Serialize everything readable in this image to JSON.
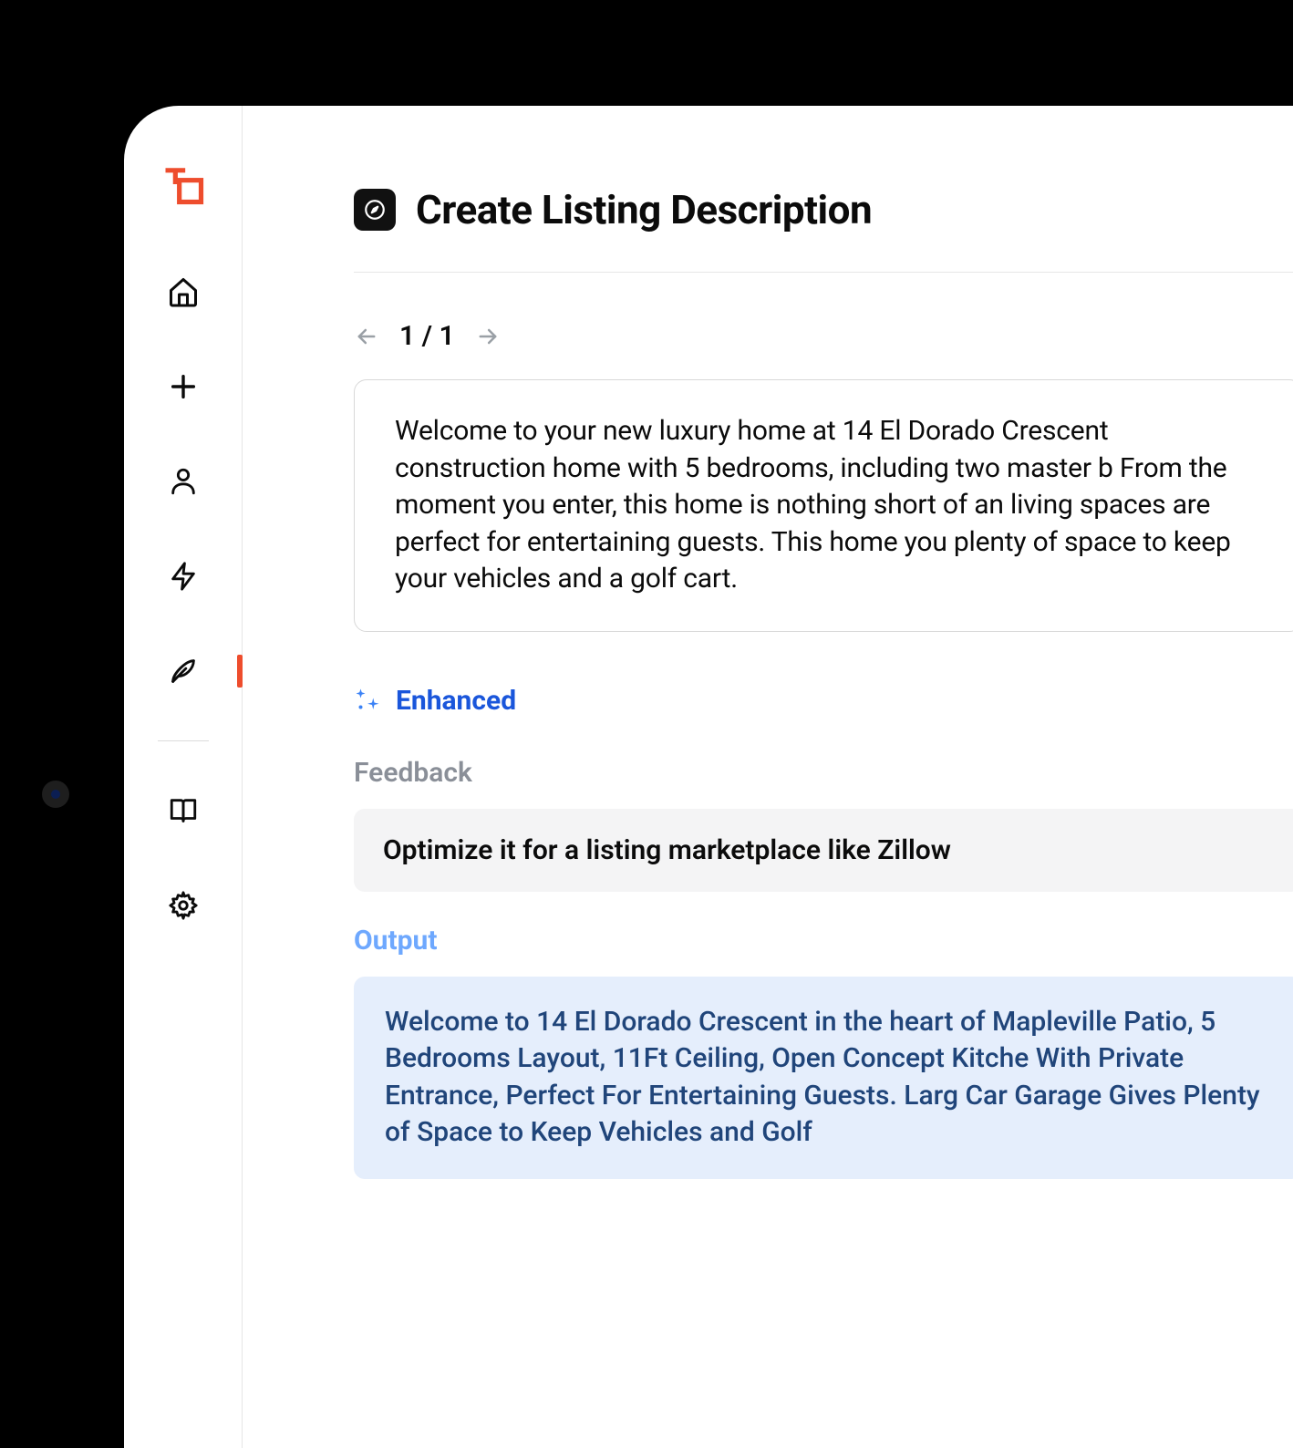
{
  "sidebar": {
    "logo": "to-logo",
    "items": [
      {
        "name": "home-icon"
      },
      {
        "name": "plus-icon"
      },
      {
        "name": "person-icon"
      },
      {
        "name": "bolt-icon"
      },
      {
        "name": "feather-icon",
        "active": true
      },
      {
        "name": "book-icon"
      },
      {
        "name": "gear-icon"
      }
    ]
  },
  "header": {
    "icon": "compass-icon",
    "title": "Create Listing Description"
  },
  "pager": {
    "current": 1,
    "total": 1,
    "display": "1 / 1"
  },
  "input_text": "Welcome to your new luxury home at 14 El Dorado Crescent construction home with 5 bedrooms, including two master b From the moment you enter, this home is nothing short of an living spaces are perfect for entertaining guests. This home you plenty of space to keep your vehicles and a golf cart.",
  "enhanced_label": "Enhanced",
  "feedback": {
    "heading": "Feedback",
    "text": "Optimize it for a listing marketplace like Zillow"
  },
  "output": {
    "heading": "Output",
    "text": "Welcome to 14 El Dorado Crescent in the heart of Mapleville Patio, 5 Bedrooms Layout, 11Ft Ceiling, Open Concept Kitche With Private Entrance, Perfect For Entertaining Guests. Larg Car Garage Gives Plenty of Space to Keep Vehicles and Golf"
  }
}
